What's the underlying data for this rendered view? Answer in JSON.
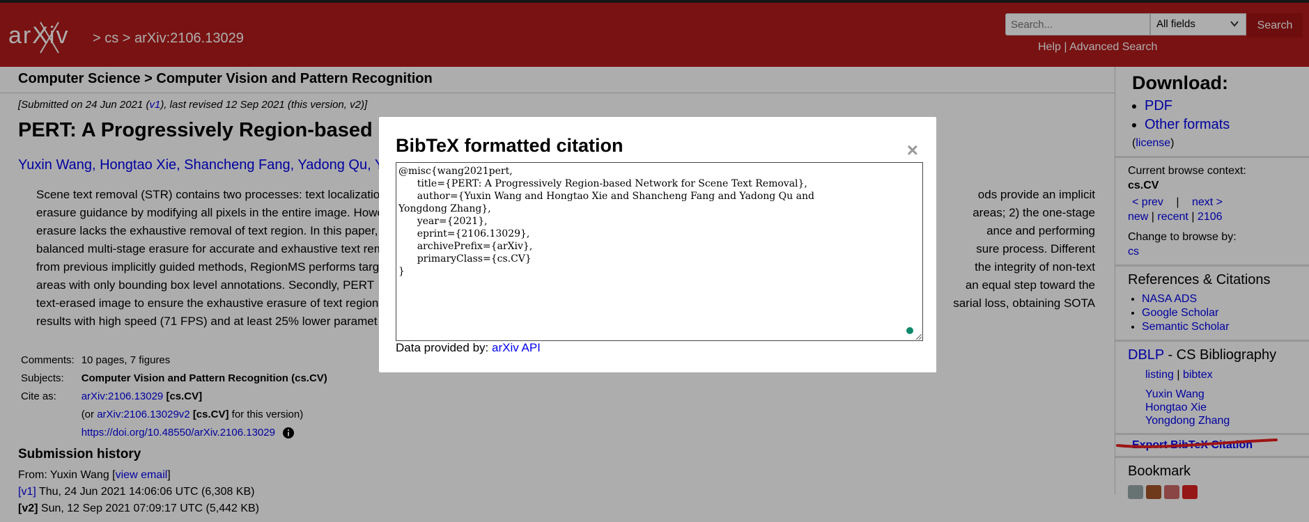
{
  "header": {
    "logo_text": "arXiv",
    "breadcrumb": "> cs > arXiv:2106.13029",
    "search_placeholder": "Search...",
    "search_field": "All fields",
    "search_button": "Search",
    "help": "Help",
    "advanced": "Advanced Search",
    "sep": "|"
  },
  "subheader": {
    "title": "Computer Science > Computer Vision and Pattern Recognition"
  },
  "paper": {
    "submitted_prefix": "[Submitted on 24 Jun 2021 (",
    "submitted_v1": "v1",
    "submitted_suffix": "), last revised 12 Sep 2021 (this version, v2)]",
    "title": "PERT: A Progressively Region-based",
    "authors": "Yuxin Wang, Hongtao Xie, Shancheng Fang, Yadong Qu, Y",
    "abstract_lines": [
      "Scene text removal (STR) contains two processes: text localizatio",
      "erasure guidance by modifying all pixels in the entire image. Howe",
      "erasure lacks the exhaustive removal of text region. In this paper,",
      "balanced multi-stage erasure for accurate and exhaustive text rem",
      "from previous implicitly guided methods, RegionMS performs targ",
      "areas with only bounding box level annotations. Secondly, PERT",
      "text-erased image to ensure the exhaustive erasure of text region",
      "results with high speed (71 FPS) and at least 25% lower paramet"
    ],
    "abstract_right": [
      "ods provide an implicit",
      "areas; 2) the one-stage",
      "ance and performing",
      "sure process. Different",
      "the integrity of non-text",
      "an equal step toward the",
      "sarial loss, obtaining SOTA",
      ""
    ]
  },
  "meta": {
    "comments_label": "Comments:",
    "comments": "10 pages, 7 figures",
    "subjects_label": "Subjects:",
    "subjects": "Computer Vision and Pattern Recognition (cs.CV)",
    "cite_label": "Cite as:",
    "cite_link": "arXiv:2106.13029",
    "cite_suffix": "[cs.CV]",
    "cite2_prefix": "(or",
    "cite2_link": "arXiv:2106.13029v2",
    "cite2_cat": "[cs.CV]",
    "cite2_suffix": "for this version)",
    "doi": "https://doi.org/10.48550/arXiv.2106.13029"
  },
  "submission": {
    "heading": "Submission history",
    "from_prefix": "From: Yuxin Wang [",
    "view_email": "view email",
    "from_suffix": "]",
    "v1_link": "[v1]",
    "v1_text": "Thu, 24 Jun 2021 14:06:06 UTC (6,308 KB)",
    "v2_label": "[v2]",
    "v2_text": "Sun, 12 Sep 2021 07:09:17 UTC (5,442 KB)"
  },
  "sidebar": {
    "download_heading": "Download:",
    "pdf": "PDF",
    "other_formats": "Other formats",
    "license": "license",
    "browse_context_label": "Current browse context:",
    "browse_context": "cs.CV",
    "prev": "< prev",
    "next": "next >",
    "new": "new",
    "recent": "recent",
    "year": "2106",
    "change_label": "Change to browse by:",
    "cs": "cs",
    "refs_heading": "References & Citations",
    "nasa": "NASA ADS",
    "google": "Google Scholar",
    "semantic": "Semantic Scholar",
    "dblp": "DBLP",
    "dblp_suffix": "- CS Bibliography",
    "listing": "listing",
    "bibtex": "bibtex",
    "authors": [
      "Yuxin Wang",
      "Hongtao Xie",
      "Yongdong Zhang"
    ],
    "export": "Export BibTeX Citation",
    "bookmark": "Bookmark"
  },
  "modal": {
    "title": "BibTeX formatted citation",
    "close": "×",
    "bibtex": "@misc{wang2021pert,\n      title={PERT: A Progressively Region-based Network for Scene Text Removal},\n      author={Yuxin Wang and Hongtao Xie and Shancheng Fang and Yadong Qu and\nYongdong Zhang},\n      year={2021},\n      eprint={2106.13029},\n      archivePrefix={arXiv},\n      primaryClass={cs.CV}\n}",
    "provided_prefix": "Data provided by:",
    "provided_link": "arXiv API"
  },
  "colors": {
    "header": "#b31b1b",
    "link": "#0000ee",
    "annotation": "#e8201e"
  }
}
